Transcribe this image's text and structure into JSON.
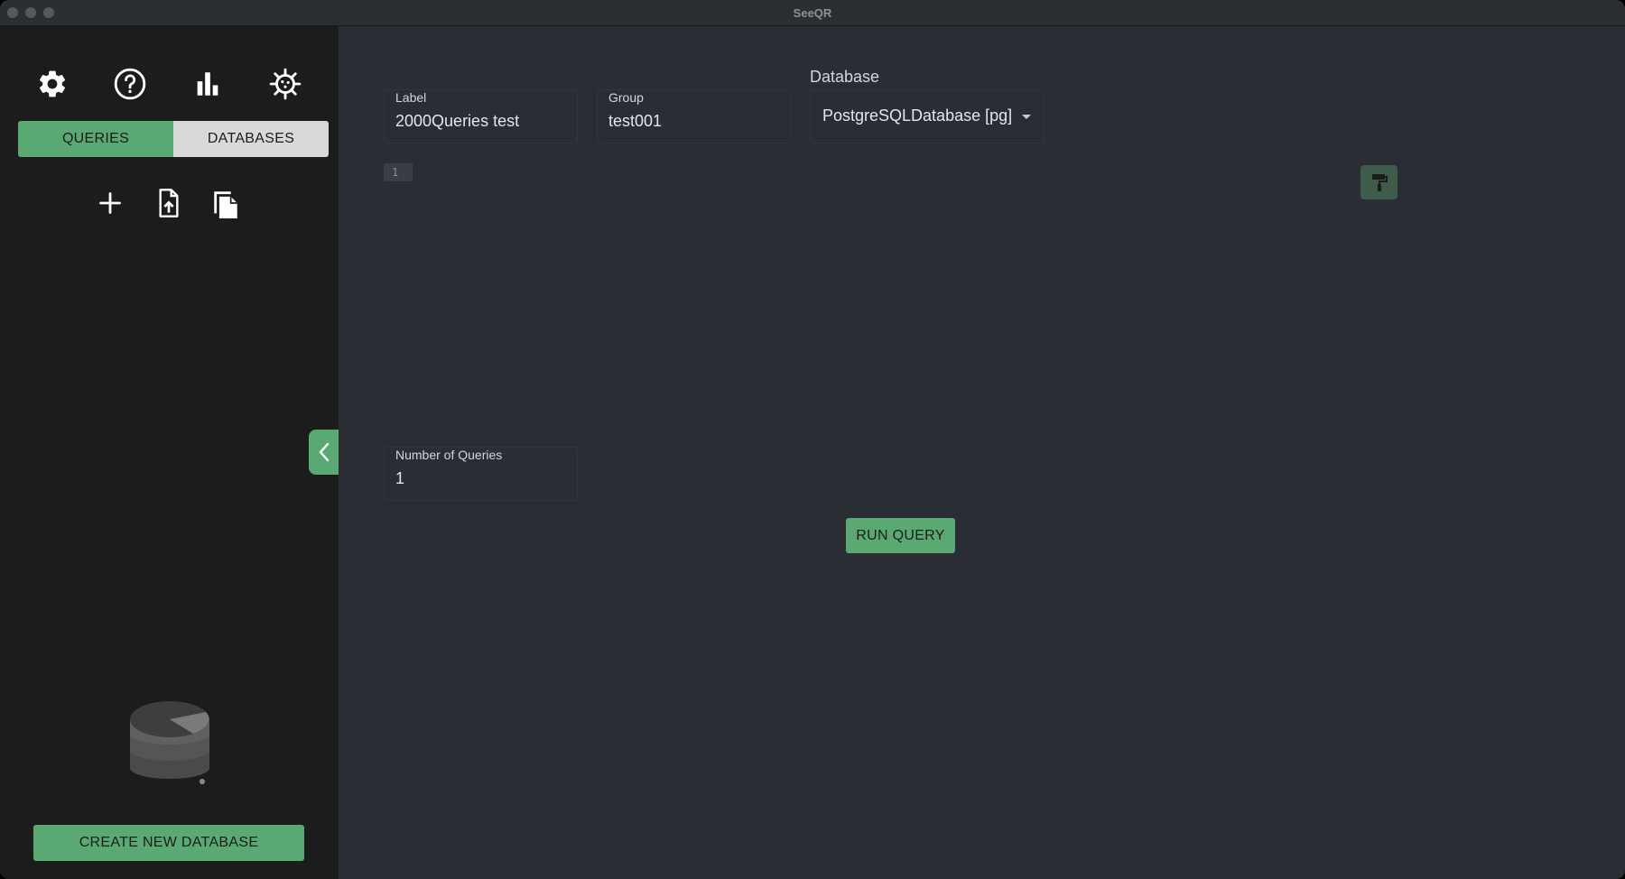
{
  "window": {
    "title": "SeeQR"
  },
  "sidebar": {
    "top_icons": [
      "gear-icon",
      "help-icon",
      "bar-chart-icon",
      "virus-icon"
    ],
    "tabs": [
      {
        "label": "QUERIES",
        "active": true
      },
      {
        "label": "DATABASES",
        "active": false
      }
    ],
    "actions": [
      "add-icon",
      "upload-file-icon",
      "copy-icon"
    ],
    "create_button": "CREATE NEW DATABASE"
  },
  "main": {
    "label_field": {
      "label": "Label",
      "value": "2000Queries test"
    },
    "group_field": {
      "label": "Group",
      "value": "test001"
    },
    "database": {
      "label": "Database",
      "value": "PostgreSQLDatabase [pg]"
    },
    "editor": {
      "line_number": "1"
    },
    "num_queries": {
      "label": "Number of Queries",
      "value": "1"
    },
    "run_button": "RUN QUERY"
  },
  "colors": {
    "accent": "#5aa973",
    "sidebar_bg": "#1c1c1c",
    "main_bg": "#2a2d34"
  }
}
